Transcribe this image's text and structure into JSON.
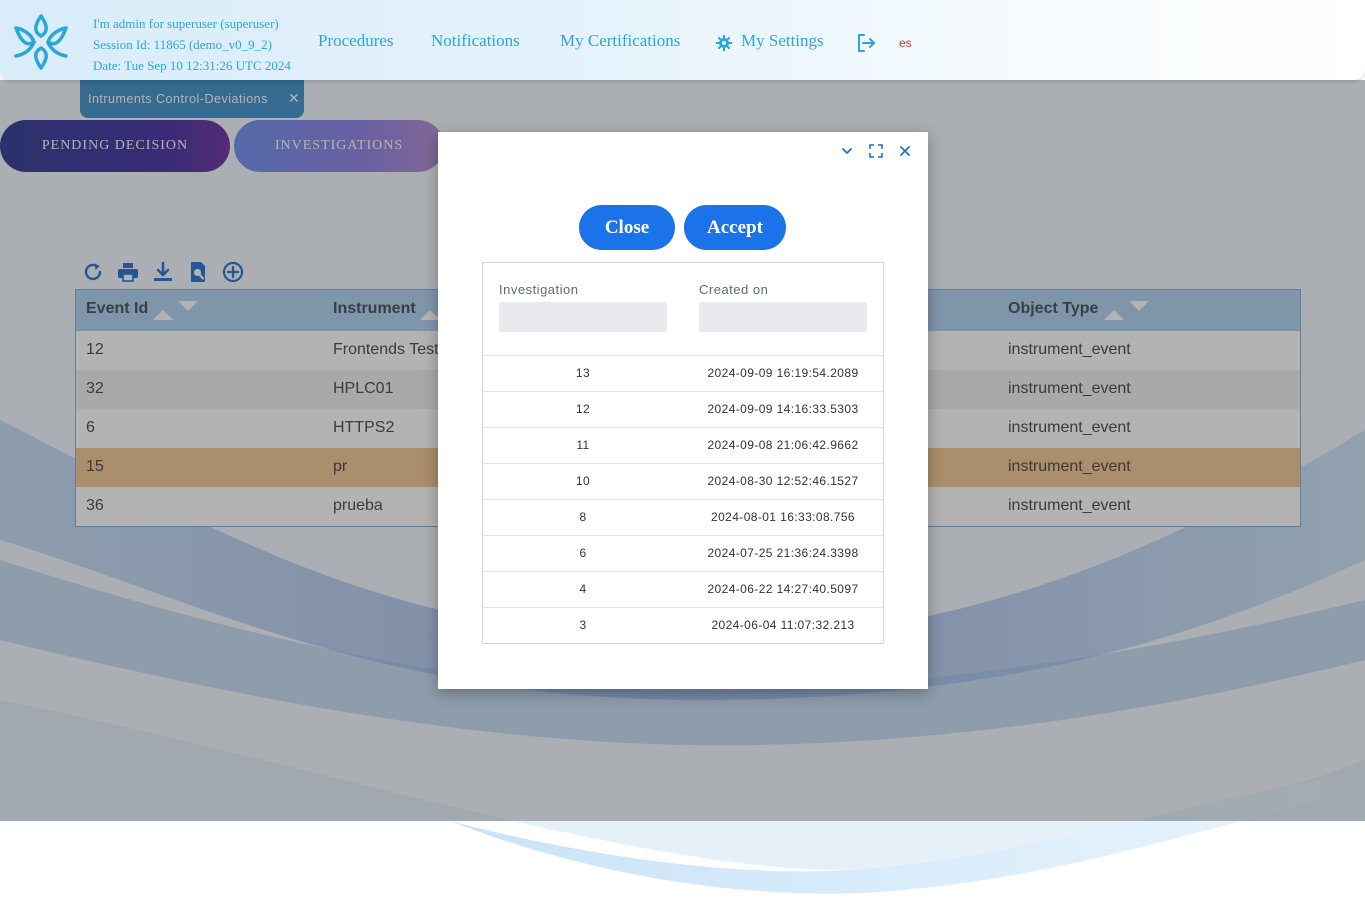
{
  "header": {
    "session_lines": [
      "I'm admin for superuser (superuser)",
      "Session Id: 11865 (demo_v0_9_2)",
      "Date: Tue Sep 10 12:31:26 UTC 2024"
    ],
    "nav": {
      "procedures": "Procedures",
      "notifications": "Notifications",
      "certifications": "My Certifications",
      "settings": "My Settings"
    },
    "language": "es"
  },
  "tab": {
    "label": "Intruments Control-Deviations"
  },
  "pills": {
    "pending": "PENDING DECISION",
    "investigations": "INVESTIGATIONS"
  },
  "toolbar_icons": [
    "refresh-icon",
    "print-icon",
    "download-icon",
    "search-document-icon",
    "add-circle-icon"
  ],
  "grid": {
    "columns": {
      "event_id": "Event Id",
      "instrument": "Instrument",
      "object_type": "Object Type"
    },
    "rows": [
      {
        "event_id": "12",
        "instrument": "Frontends Test",
        "object_type": "instrument_event"
      },
      {
        "event_id": "32",
        "instrument": "HPLC01",
        "object_type": "instrument_event"
      },
      {
        "event_id": "6",
        "instrument": "HTTPS2",
        "object_type": "instrument_event"
      },
      {
        "event_id": "15",
        "instrument": "pr",
        "object_type": "instrument_event"
      },
      {
        "event_id": "36",
        "instrument": "prueba",
        "object_type": "instrument_event"
      }
    ],
    "selected_row_color": "#f2c58f"
  },
  "dialog": {
    "close_label": "Close",
    "accept_label": "Accept",
    "columns": {
      "investigation": "Investigation",
      "created_on": "Created on"
    },
    "filters": {
      "investigation": "",
      "created_on": ""
    },
    "rows": [
      {
        "id": "13",
        "created": "2024-09-09 16:19:54.2089"
      },
      {
        "id": "12",
        "created": "2024-09-09 14:16:33.5303"
      },
      {
        "id": "11",
        "created": "2024-09-08 21:06:42.9662"
      },
      {
        "id": "10",
        "created": "2024-08-30 12:52:46.1527"
      },
      {
        "id": "8",
        "created": "2024-08-01 16:33:08.756"
      },
      {
        "id": "6",
        "created": "2024-07-25 21:36:24.3398"
      },
      {
        "id": "4",
        "created": "2024-06-22 14:27:40.5097"
      },
      {
        "id": "3",
        "created": "2024-06-04 11:07:32.213"
      }
    ]
  },
  "colors": {
    "accent": "#1a73e8",
    "nav_text": "#2ba6d9",
    "grid_header": "#aed1f1"
  }
}
